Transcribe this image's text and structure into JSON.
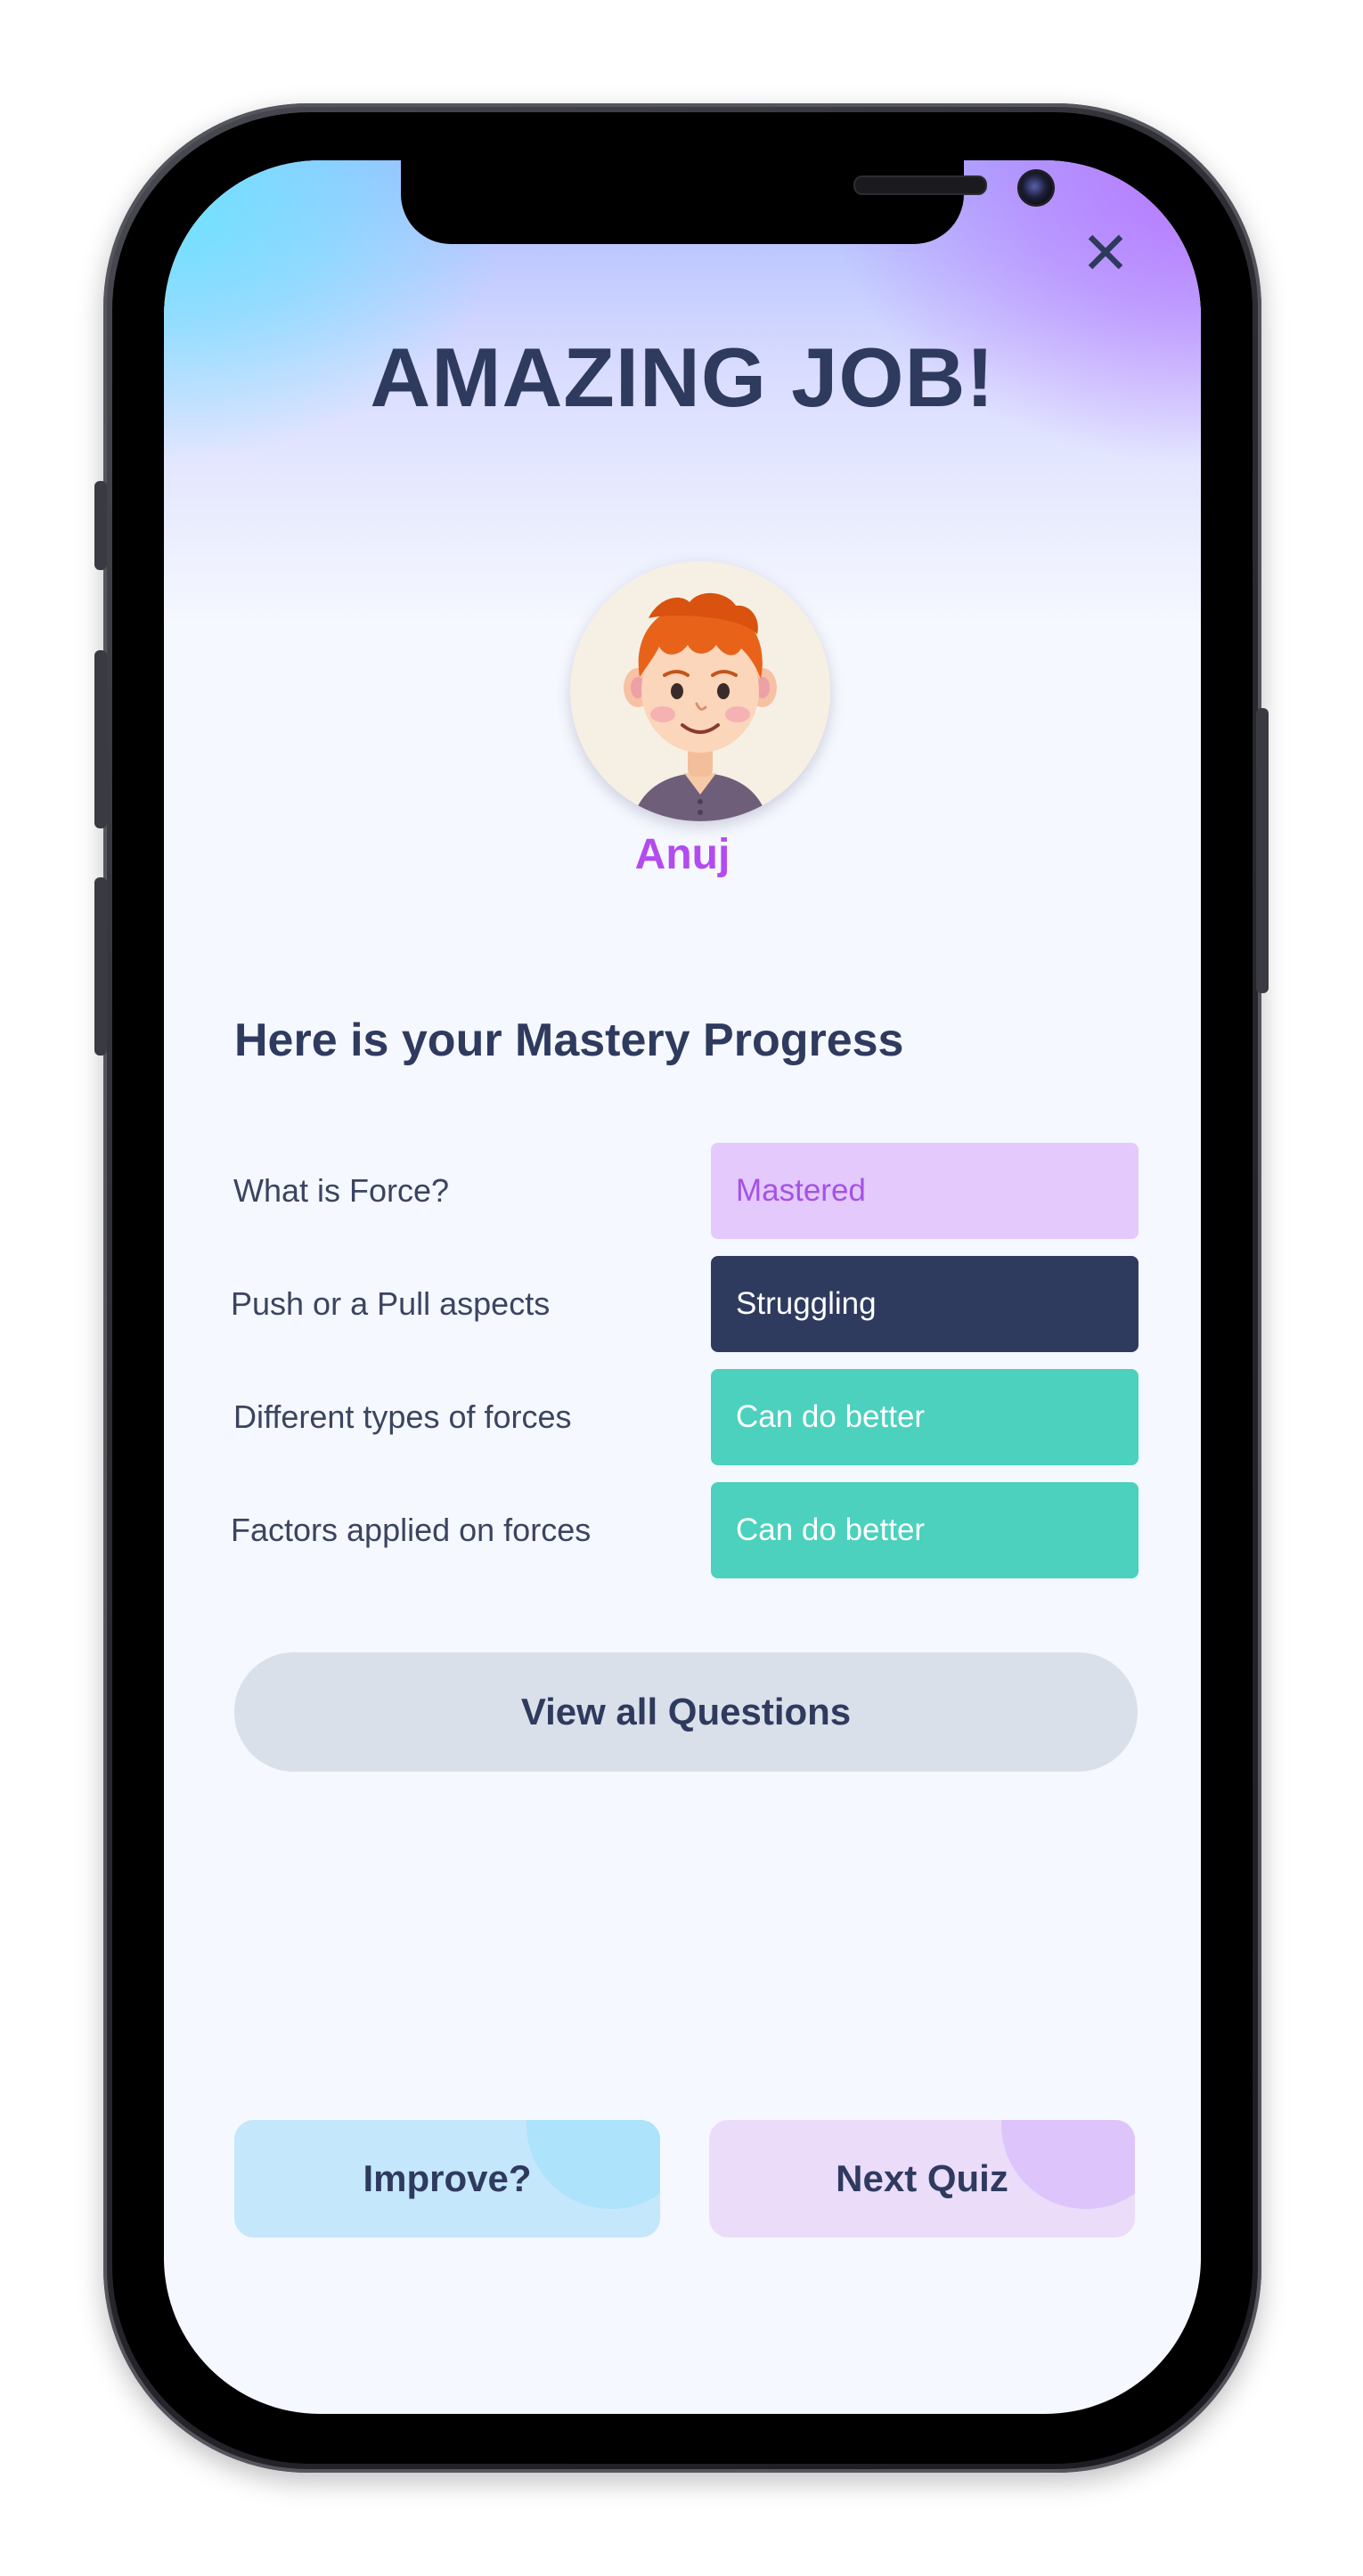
{
  "header": {
    "close_glyph": "✕",
    "title": "AMAZING JOB!"
  },
  "profile": {
    "name": "Anuj"
  },
  "mastery": {
    "title": "Here is your Mastery Progress",
    "rows": [
      {
        "topic": "What is Force?",
        "status": "Mastered"
      },
      {
        "topic": "Push or a Pull aspects",
        "status": "Struggling"
      },
      {
        "topic": "Different types of forces",
        "status": "Can do better"
      },
      {
        "topic": "Factors applied on forces",
        "status": "Can do better"
      }
    ]
  },
  "actions": {
    "view_all": "View all Questions",
    "improve": "Improve?",
    "next_quiz": "Next Quiz"
  },
  "colors": {
    "primary_text": "#2f3a5f",
    "accent_purple": "#b34bf0",
    "mastered_bg": "#e3c9fc",
    "struggling_bg": "#2f3a5f",
    "can_do_better_bg": "#4bd1bd"
  }
}
